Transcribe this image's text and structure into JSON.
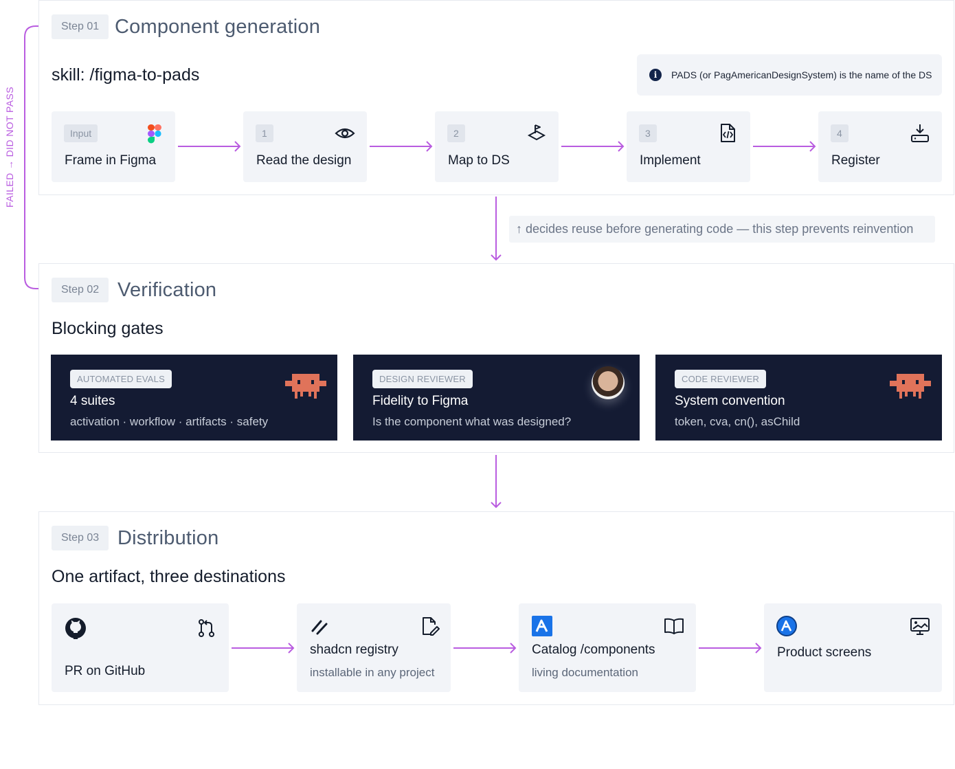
{
  "loop_label": "FAILED → DID NOT PASS",
  "step1": {
    "tag": "Step 01",
    "title": "Component generation",
    "skill": "skill: /figma-to-pads",
    "info": "PADS (or PagAmericanDesignSystem) is the name of the DS",
    "cards": [
      {
        "badge": "Input",
        "label": "Frame in Figma",
        "icon": "figma-icon"
      },
      {
        "badge": "1",
        "label": "Read the design",
        "icon": "eye-icon"
      },
      {
        "badge": "2",
        "label": "Map to DS",
        "icon": "map-pin-layers-icon"
      },
      {
        "badge": "3",
        "label": "Implement",
        "icon": "code-file-icon"
      },
      {
        "badge": "4",
        "label": "Register",
        "icon": "download-tray-icon"
      }
    ],
    "note": "↑ decides reuse before generating code — this step prevents reinvention"
  },
  "step2": {
    "tag": "Step 02",
    "title": "Verification",
    "subhead": "Blocking gates",
    "gates": [
      {
        "badge": "AUTOMATED EVALS",
        "title": "4 suites",
        "sub": "activation · workflow · artifacts · safety",
        "icon": "robot-icon"
      },
      {
        "badge": "DESIGN REVIEWER",
        "title": "Fidelity to Figma",
        "sub": "Is the component what was designed?",
        "icon": "avatar"
      },
      {
        "badge": "CODE REVIEWER",
        "title": "System convention",
        "sub": "token, cva, cn(), asChild",
        "icon": "robot-icon"
      }
    ]
  },
  "step3": {
    "tag": "Step 03",
    "title": "Distribution",
    "subhead": "One artifact, three destinations",
    "cards": [
      {
        "label": "PR on GitHub",
        "sub": "",
        "icons": [
          "github-icon",
          "pull-request-icon"
        ]
      },
      {
        "label": "shadcn registry",
        "sub": "installable in any project",
        "icons": [
          "shadcn-icon",
          "edit-file-icon"
        ]
      },
      {
        "label": "Catalog /components",
        "sub": "living documentation",
        "icons": [
          "app-logo-icon",
          "book-icon"
        ]
      },
      {
        "label": "Product screens",
        "sub": "",
        "icons": [
          "app-logo-round-icon",
          "screen-image-icon"
        ]
      }
    ]
  },
  "colors": {
    "accent": "#b95ce0",
    "card_bg": "#f2f4f8",
    "gate_bg": "#141b33",
    "robot": "#e0735a",
    "brand_blue": "#1a73e8"
  }
}
